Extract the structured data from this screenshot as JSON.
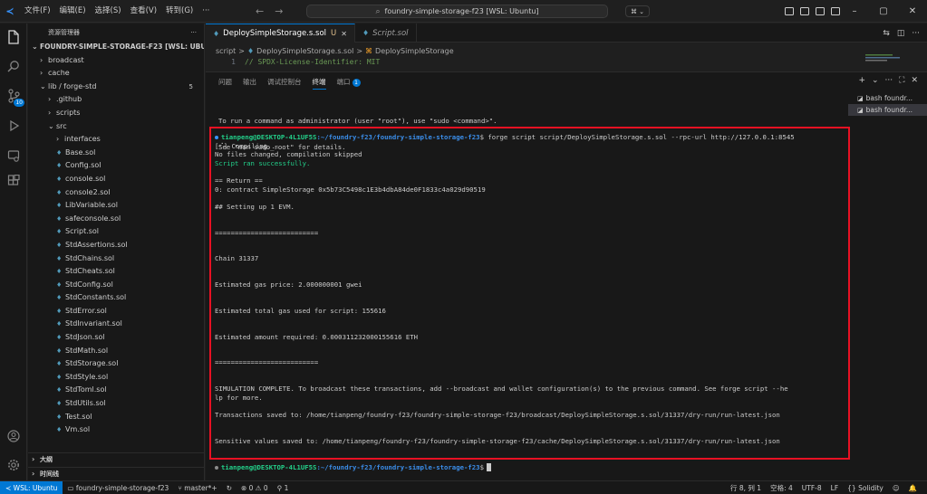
{
  "titlebar": {
    "logo": "≺",
    "menus": [
      "文件(F)",
      "编辑(E)",
      "选择(S)",
      "查看(V)",
      "转到(G)",
      "···"
    ],
    "nav_back": "←",
    "nav_forward": "→",
    "search_text": "foundry-simple-storage-f23 [WSL: Ubuntu]",
    "copilot": "⌘ ⌄",
    "window_controls": [
      "–",
      "▢",
      "✕"
    ]
  },
  "sidebar": {
    "header": "资源管理器",
    "header_more": "···",
    "root": "FOUNDRY-SIMPLE-STORAGE-F23 [WSL: UBUNTU]",
    "items": [
      {
        "label": "broadcast",
        "type": "folder",
        "indent": 1,
        "open": false
      },
      {
        "label": "cache",
        "type": "folder",
        "indent": 1,
        "open": false
      },
      {
        "label": "lib / forge-std",
        "type": "folder",
        "indent": 1,
        "open": true,
        "count": "5"
      },
      {
        "label": ".github",
        "type": "folder",
        "indent": 2,
        "open": false
      },
      {
        "label": "scripts",
        "type": "folder",
        "indent": 2,
        "open": false
      },
      {
        "label": "src",
        "type": "folder",
        "indent": 2,
        "open": true
      },
      {
        "label": "interfaces",
        "type": "folder",
        "indent": 3,
        "open": false
      },
      {
        "label": "Base.sol",
        "type": "file",
        "indent": 3
      },
      {
        "label": "Config.sol",
        "type": "file",
        "indent": 3
      },
      {
        "label": "console.sol",
        "type": "file",
        "indent": 3
      },
      {
        "label": "console2.sol",
        "type": "file",
        "indent": 3
      },
      {
        "label": "LibVariable.sol",
        "type": "file",
        "indent": 3
      },
      {
        "label": "safeconsole.sol",
        "type": "file",
        "indent": 3
      },
      {
        "label": "Script.sol",
        "type": "file",
        "indent": 3
      },
      {
        "label": "StdAssertions.sol",
        "type": "file",
        "indent": 3
      },
      {
        "label": "StdChains.sol",
        "type": "file",
        "indent": 3
      },
      {
        "label": "StdCheats.sol",
        "type": "file",
        "indent": 3
      },
      {
        "label": "StdConfig.sol",
        "type": "file",
        "indent": 3
      },
      {
        "label": "StdConstants.sol",
        "type": "file",
        "indent": 3
      },
      {
        "label": "StdError.sol",
        "type": "file",
        "indent": 3
      },
      {
        "label": "StdInvariant.sol",
        "type": "file",
        "indent": 3
      },
      {
        "label": "StdJson.sol",
        "type": "file",
        "indent": 3
      },
      {
        "label": "StdMath.sol",
        "type": "file",
        "indent": 3
      },
      {
        "label": "StdStorage.sol",
        "type": "file",
        "indent": 3
      },
      {
        "label": "StdStyle.sol",
        "type": "file",
        "indent": 3
      },
      {
        "label": "StdToml.sol",
        "type": "file",
        "indent": 3
      },
      {
        "label": "StdUtils.sol",
        "type": "file",
        "indent": 3
      },
      {
        "label": "Test.sol",
        "type": "file",
        "indent": 3
      },
      {
        "label": "Vm.sol",
        "type": "file",
        "indent": 3
      }
    ],
    "outline": "大纲",
    "timeline": "时间线"
  },
  "tabs": [
    {
      "label": "DeploySimpleStorage.s.sol",
      "modified": "U",
      "close": "✕",
      "active": true
    },
    {
      "label": "Script.sol",
      "active": false
    }
  ],
  "tab_actions": [
    "⇆",
    "◫",
    "···"
  ],
  "breadcrumb": {
    "parts": [
      "script",
      ">",
      "DeploySimpleStorage.s.sol",
      ">",
      "DeploySimpleStorage"
    ]
  },
  "editor": {
    "line_number": "1",
    "line_text": "// SPDX-License-Identifier: MIT"
  },
  "panel": {
    "tabs": [
      {
        "label": "问题",
        "active": false
      },
      {
        "label": "输出",
        "active": false
      },
      {
        "label": "调试控制台",
        "active": false
      },
      {
        "label": "终端",
        "active": true
      },
      {
        "label": "端口",
        "active": false,
        "badge": "1"
      }
    ],
    "actions": [
      "+",
      "⌄",
      "···",
      "⛶",
      "✕"
    ],
    "terminals": [
      {
        "label": "bash foundr...",
        "active": false
      },
      {
        "label": "bash foundr...",
        "active": true
      }
    ]
  },
  "terminal": {
    "pre_lines": [
      "To run a command as administrator (user \"root\"), use \"sudo <command>\".",
      "See \"man sudo_root\" for details."
    ],
    "prompt_user": "tianpeng@DESKTOP-4L1UF5S",
    "prompt_path": ":~/foundry-f23/foundry-simple-storage-f23",
    "prompt_symbol": "$",
    "command": " forge script script/DeploySimpleStorage.s.sol --rpc-url http://127.0.0.1:8545",
    "compiling": "[⠊] Compiling...",
    "no_change": "No files changed, compilation skipped",
    "success": "Script ran successfully.",
    "return_header": "== Return ==",
    "return_value": "0: contract SimpleStorage 0x5b73C5498c1E3b4dbA84de0F1833c4a029d90519",
    "evm_setup": "## Setting up 1 EVM.",
    "separator1": "==========================",
    "chain": "Chain 31337",
    "gas_price": "Estimated gas price: 2.000000001 gwei",
    "gas_used": "Estimated total gas used for script: 155616",
    "amount": "Estimated amount required: 0.000311232000155616 ETH",
    "separator2": "==========================",
    "simulation_1": "SIMULATION COMPLETE. To broadcast these transactions, add --broadcast and wallet configuration(s) to the previous command. See forge script --he",
    "simulation_2": "lp for more.",
    "tx_saved": "Transactions saved to: /home/tianpeng/foundry-f23/foundry-simple-storage-f23/broadcast/DeploySimpleStorage.s.sol/31337/dry-run/run-latest.json",
    "sensitive_saved": "Sensitive values saved to: /home/tianpeng/foundry-f23/foundry-simple-storage-f23/cache/DeploySimpleStorage.s.sol/31337/dry-run/run-latest.json"
  },
  "statusbar": {
    "remote": "≺ WSL: Ubuntu",
    "project": "foundry-simple-storage-f23",
    "branch": "master*+",
    "sync": "↻",
    "problems": "⊗ 0 ⚠ 0",
    "ports": "⚲ 1",
    "cursor_pos": "行 8, 列 1",
    "spaces": "空格: 4",
    "encoding": "UTF-8",
    "eol": "LF",
    "language": "{} Solidity",
    "copilot": "☺",
    "notifications": "🔔"
  },
  "colors": {
    "accent": "#0078d4",
    "highlight_border": "#e81123",
    "prompt_green": "#23d18b",
    "prompt_blue": "#3b8eea"
  }
}
